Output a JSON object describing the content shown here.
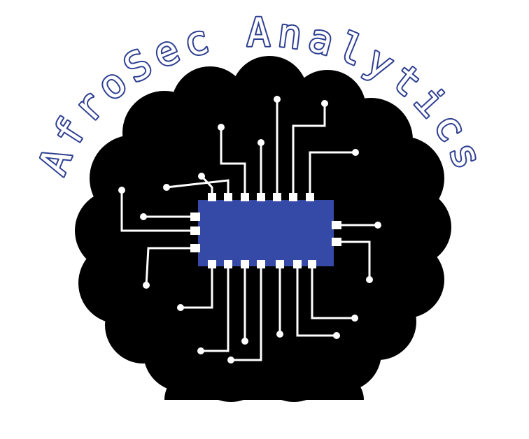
{
  "logo": {
    "brand_name": "AfroSec Analytics",
    "colors": {
      "background": "#ffffff",
      "silhouette": "#000000",
      "chip": "#3549a6",
      "text_fill": "#ffffff",
      "text_outline": "#2e3f91",
      "traces": "#ffffff"
    },
    "icons": [
      "afro-silhouette",
      "microchip",
      "circuit-traces"
    ]
  }
}
